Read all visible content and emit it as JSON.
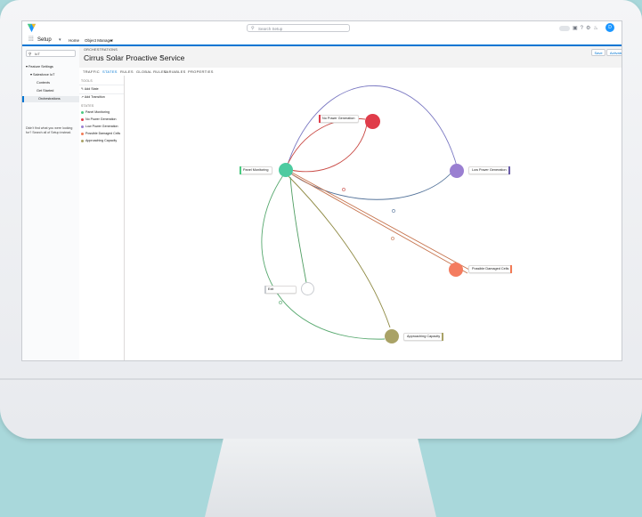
{
  "header": {
    "search_placeholder": "Search Setup",
    "avatar_initial": "D"
  },
  "appbar": {
    "app_name": "Setup",
    "tabs": [
      {
        "label": "Home"
      },
      {
        "label": "Object Manager"
      }
    ]
  },
  "sidebar": {
    "quickfind_value": "IoT",
    "items": [
      {
        "label": "Feature Settings"
      },
      {
        "label": "Salesforce IoT"
      },
      {
        "label": "Contexts"
      },
      {
        "label": "Get Started"
      },
      {
        "label": "Orchestrations"
      }
    ],
    "note_text": "Didn't find what you were looking for? Search all of Setup instead."
  },
  "page": {
    "eyebrow": "ORCHESTRATIONS",
    "title": "Cirrus Solar Proactive Service",
    "save_label": "Save",
    "activate_label": "Activate"
  },
  "tabs": [
    {
      "label": "TRAFFIC"
    },
    {
      "label": "STATES"
    },
    {
      "label": "RULES"
    },
    {
      "label": "GLOBAL RULES"
    },
    {
      "label": "VARIABLES"
    },
    {
      "label": "PROPERTIES"
    }
  ],
  "palette": {
    "tools_label": "TOOLS",
    "actions": [
      {
        "label": "Add State"
      },
      {
        "label": "Add Transition"
      }
    ],
    "states_label": "STATES",
    "states": [
      {
        "label": "Panel Monitoring",
        "color": "#4bca81"
      },
      {
        "label": "No Power Generation",
        "color": "#e03c4a"
      },
      {
        "label": "Low Power Generation",
        "color": "#9a7fd1"
      },
      {
        "label": "Possible Damaged Cells",
        "color": "#f27a55"
      },
      {
        "label": "Approaching Capacity",
        "color": "#a9a266"
      }
    ]
  },
  "diagram": {
    "nodes": [
      {
        "id": "panel",
        "label": "Panel Monitoring",
        "color": "#4ecba0"
      },
      {
        "id": "nopower",
        "label": "No Power Generation",
        "color": "#e03c4a"
      },
      {
        "id": "lowpower",
        "label": "Low Power Generation",
        "color": "#9a7fd1"
      },
      {
        "id": "damaged",
        "label": "Possible Damaged Cells",
        "color": "#f47c5f"
      },
      {
        "id": "capacity",
        "label": "Approaching Capacity",
        "color": "#a9a266"
      },
      {
        "id": "exit",
        "label": "Exit",
        "color": "#ffffff"
      }
    ]
  }
}
